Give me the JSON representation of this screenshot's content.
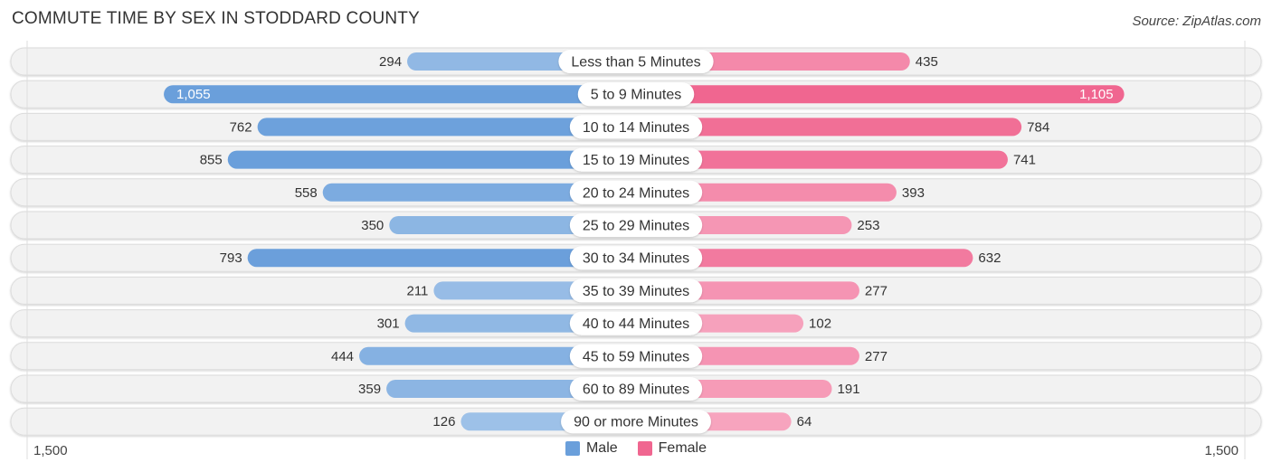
{
  "header": {
    "title": "COMMUTE TIME BY SEX IN STODDARD COUNTY",
    "source": "Source: ZipAtlas.com"
  },
  "colors": {
    "male": "#6a9fdb",
    "male_light": "#a7c7ea",
    "female": "#f06690",
    "female_light": "#f7a9c2",
    "track": "#f2f2f2"
  },
  "legend": [
    {
      "label": "Male",
      "color": "#6a9fdb"
    },
    {
      "label": "Female",
      "color": "#f06690"
    }
  ],
  "chart_data": {
    "type": "bar",
    "orientation": "horizontal-diverging",
    "title": "COMMUTE TIME BY SEX IN STODDARD COUNTY",
    "categories": [
      "Less than 5 Minutes",
      "5 to 9 Minutes",
      "10 to 14 Minutes",
      "15 to 19 Minutes",
      "20 to 24 Minutes",
      "25 to 29 Minutes",
      "30 to 34 Minutes",
      "35 to 39 Minutes",
      "40 to 44 Minutes",
      "45 to 59 Minutes",
      "60 to 89 Minutes",
      "90 or more Minutes"
    ],
    "series": [
      {
        "name": "Male",
        "values": [
          294,
          1055,
          762,
          855,
          558,
          350,
          793,
          211,
          301,
          444,
          359,
          126
        ],
        "labels": [
          "294",
          "1,055",
          "762",
          "855",
          "558",
          "350",
          "793",
          "211",
          "301",
          "444",
          "359",
          "126"
        ]
      },
      {
        "name": "Female",
        "values": [
          435,
          1105,
          784,
          741,
          393,
          253,
          632,
          277,
          102,
          277,
          191,
          64
        ],
        "labels": [
          "435",
          "1,105",
          "784",
          "741",
          "393",
          "253",
          "632",
          "277",
          "102",
          "277",
          "191",
          "64"
        ]
      }
    ],
    "xlim": [
      -1500,
      1500
    ],
    "axis_tick_labels": {
      "left": "1,500",
      "right": "1,500"
    },
    "legend_position": "bottom-center",
    "grid": false
  }
}
